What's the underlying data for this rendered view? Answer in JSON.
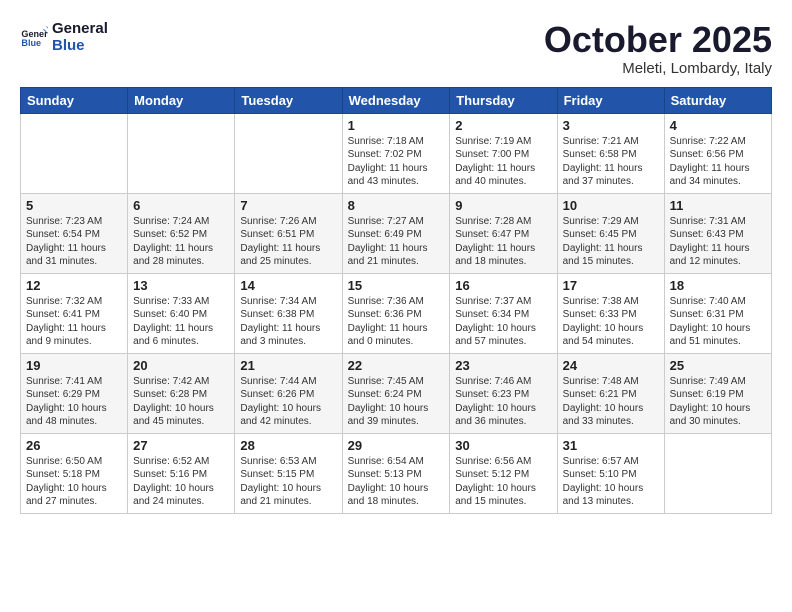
{
  "header": {
    "logo_general": "General",
    "logo_blue": "Blue",
    "month": "October 2025",
    "location": "Meleti, Lombardy, Italy"
  },
  "weekdays": [
    "Sunday",
    "Monday",
    "Tuesday",
    "Wednesday",
    "Thursday",
    "Friday",
    "Saturday"
  ],
  "weeks": [
    [
      {
        "day": "",
        "info": ""
      },
      {
        "day": "",
        "info": ""
      },
      {
        "day": "",
        "info": ""
      },
      {
        "day": "1",
        "info": "Sunrise: 7:18 AM\nSunset: 7:02 PM\nDaylight: 11 hours and 43 minutes."
      },
      {
        "day": "2",
        "info": "Sunrise: 7:19 AM\nSunset: 7:00 PM\nDaylight: 11 hours and 40 minutes."
      },
      {
        "day": "3",
        "info": "Sunrise: 7:21 AM\nSunset: 6:58 PM\nDaylight: 11 hours and 37 minutes."
      },
      {
        "day": "4",
        "info": "Sunrise: 7:22 AM\nSunset: 6:56 PM\nDaylight: 11 hours and 34 minutes."
      }
    ],
    [
      {
        "day": "5",
        "info": "Sunrise: 7:23 AM\nSunset: 6:54 PM\nDaylight: 11 hours and 31 minutes."
      },
      {
        "day": "6",
        "info": "Sunrise: 7:24 AM\nSunset: 6:52 PM\nDaylight: 11 hours and 28 minutes."
      },
      {
        "day": "7",
        "info": "Sunrise: 7:26 AM\nSunset: 6:51 PM\nDaylight: 11 hours and 25 minutes."
      },
      {
        "day": "8",
        "info": "Sunrise: 7:27 AM\nSunset: 6:49 PM\nDaylight: 11 hours and 21 minutes."
      },
      {
        "day": "9",
        "info": "Sunrise: 7:28 AM\nSunset: 6:47 PM\nDaylight: 11 hours and 18 minutes."
      },
      {
        "day": "10",
        "info": "Sunrise: 7:29 AM\nSunset: 6:45 PM\nDaylight: 11 hours and 15 minutes."
      },
      {
        "day": "11",
        "info": "Sunrise: 7:31 AM\nSunset: 6:43 PM\nDaylight: 11 hours and 12 minutes."
      }
    ],
    [
      {
        "day": "12",
        "info": "Sunrise: 7:32 AM\nSunset: 6:41 PM\nDaylight: 11 hours and 9 minutes."
      },
      {
        "day": "13",
        "info": "Sunrise: 7:33 AM\nSunset: 6:40 PM\nDaylight: 11 hours and 6 minutes."
      },
      {
        "day": "14",
        "info": "Sunrise: 7:34 AM\nSunset: 6:38 PM\nDaylight: 11 hours and 3 minutes."
      },
      {
        "day": "15",
        "info": "Sunrise: 7:36 AM\nSunset: 6:36 PM\nDaylight: 11 hours and 0 minutes."
      },
      {
        "day": "16",
        "info": "Sunrise: 7:37 AM\nSunset: 6:34 PM\nDaylight: 10 hours and 57 minutes."
      },
      {
        "day": "17",
        "info": "Sunrise: 7:38 AM\nSunset: 6:33 PM\nDaylight: 10 hours and 54 minutes."
      },
      {
        "day": "18",
        "info": "Sunrise: 7:40 AM\nSunset: 6:31 PM\nDaylight: 10 hours and 51 minutes."
      }
    ],
    [
      {
        "day": "19",
        "info": "Sunrise: 7:41 AM\nSunset: 6:29 PM\nDaylight: 10 hours and 48 minutes."
      },
      {
        "day": "20",
        "info": "Sunrise: 7:42 AM\nSunset: 6:28 PM\nDaylight: 10 hours and 45 minutes."
      },
      {
        "day": "21",
        "info": "Sunrise: 7:44 AM\nSunset: 6:26 PM\nDaylight: 10 hours and 42 minutes."
      },
      {
        "day": "22",
        "info": "Sunrise: 7:45 AM\nSunset: 6:24 PM\nDaylight: 10 hours and 39 minutes."
      },
      {
        "day": "23",
        "info": "Sunrise: 7:46 AM\nSunset: 6:23 PM\nDaylight: 10 hours and 36 minutes."
      },
      {
        "day": "24",
        "info": "Sunrise: 7:48 AM\nSunset: 6:21 PM\nDaylight: 10 hours and 33 minutes."
      },
      {
        "day": "25",
        "info": "Sunrise: 7:49 AM\nSunset: 6:19 PM\nDaylight: 10 hours and 30 minutes."
      }
    ],
    [
      {
        "day": "26",
        "info": "Sunrise: 6:50 AM\nSunset: 5:18 PM\nDaylight: 10 hours and 27 minutes."
      },
      {
        "day": "27",
        "info": "Sunrise: 6:52 AM\nSunset: 5:16 PM\nDaylight: 10 hours and 24 minutes."
      },
      {
        "day": "28",
        "info": "Sunrise: 6:53 AM\nSunset: 5:15 PM\nDaylight: 10 hours and 21 minutes."
      },
      {
        "day": "29",
        "info": "Sunrise: 6:54 AM\nSunset: 5:13 PM\nDaylight: 10 hours and 18 minutes."
      },
      {
        "day": "30",
        "info": "Sunrise: 6:56 AM\nSunset: 5:12 PM\nDaylight: 10 hours and 15 minutes."
      },
      {
        "day": "31",
        "info": "Sunrise: 6:57 AM\nSunset: 5:10 PM\nDaylight: 10 hours and 13 minutes."
      },
      {
        "day": "",
        "info": ""
      }
    ]
  ]
}
